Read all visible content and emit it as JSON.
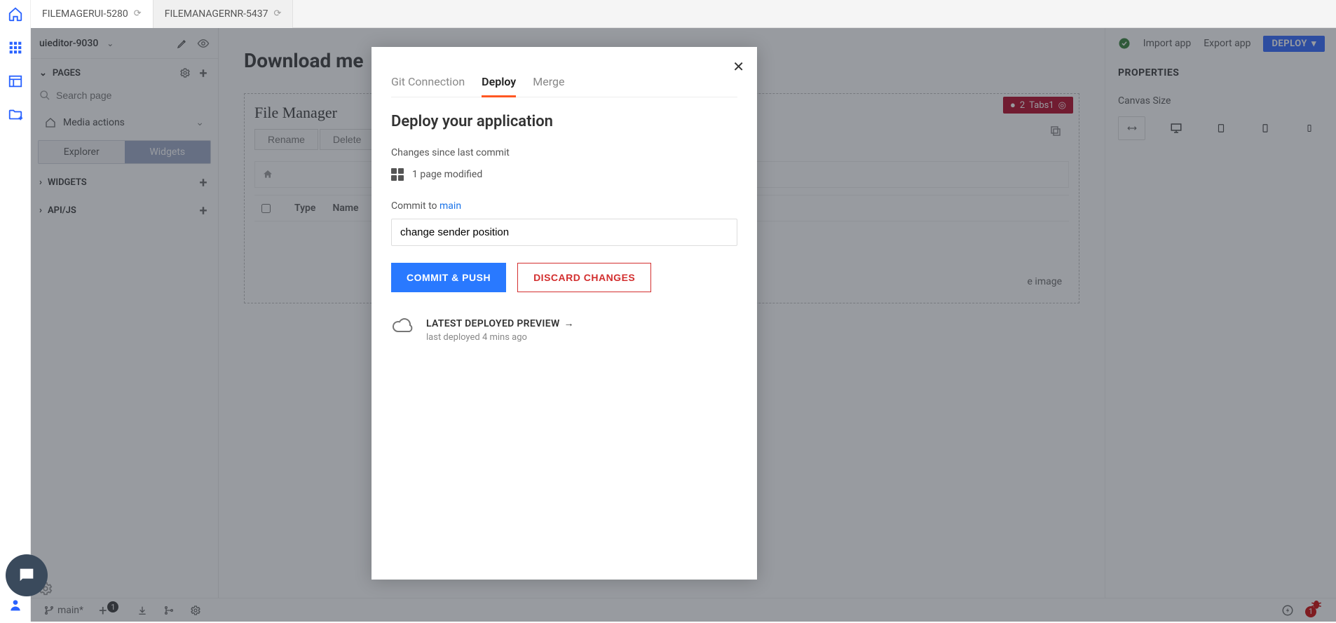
{
  "top_tabs": [
    {
      "label": "FILEMAGERUI-5280"
    },
    {
      "label": "FILEMANAGERNR-5437"
    }
  ],
  "app": {
    "name": "uieditor-9030"
  },
  "toolbar": {
    "import": "Import app",
    "export": "Export app",
    "deploy": "DEPLOY"
  },
  "sidebar": {
    "pages_label": "PAGES",
    "search_placeholder": "Search page",
    "page1": "Media actions",
    "subtabs": {
      "explorer": "Explorer",
      "widgets": "Widgets"
    },
    "widgets_section": "WIDGETS",
    "api_section": "API/JS"
  },
  "canvas": {
    "title": "Download me",
    "file_manager_title": "File Manager",
    "buttons": {
      "rename": "Rename",
      "delete": "Delete"
    },
    "table": {
      "type": "Type",
      "name": "Name"
    },
    "right_text": "e image",
    "badge": {
      "count": "2",
      "label": "Tabs1"
    }
  },
  "right_panel": {
    "title": "PROPERTIES",
    "canvas_size": "Canvas Size"
  },
  "bottom_bar": {
    "branch": "main*",
    "plus_badge": "1",
    "bug_badge": "1"
  },
  "modal": {
    "tabs": {
      "git": "Git Connection",
      "deploy": "Deploy",
      "merge": "Merge"
    },
    "title": "Deploy your application",
    "changes_label": "Changes since last commit",
    "pages_modified": "1 page modified",
    "commit_to_prefix": "Commit to ",
    "branch": "main",
    "commit_message": "change sender position",
    "commit_button": "COMMIT & PUSH",
    "discard_button": "DISCARD CHANGES",
    "preview_link": "LATEST DEPLOYED PREVIEW",
    "deploy_time": "last deployed 4 mins ago"
  }
}
